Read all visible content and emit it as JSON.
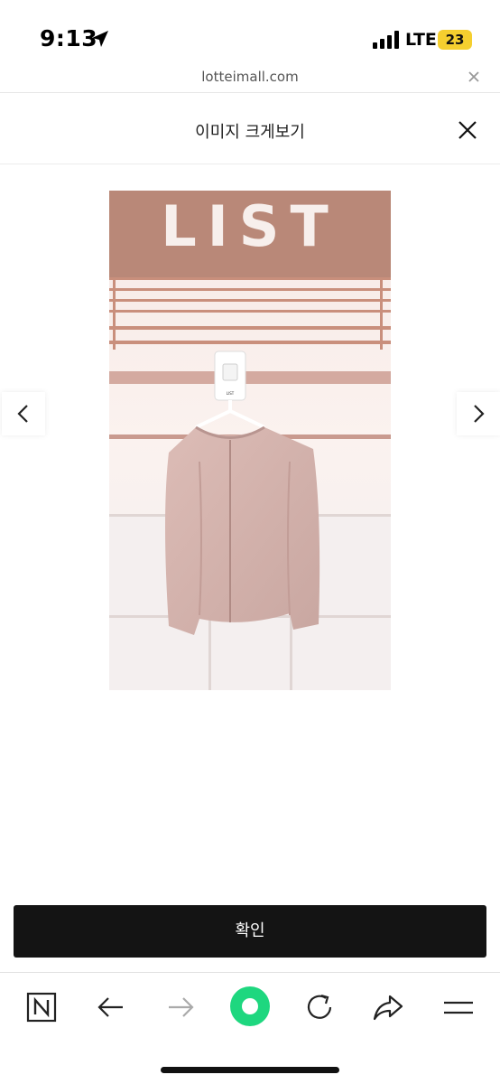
{
  "status_bar": {
    "time": "9:13",
    "network": "LTE",
    "battery": "23"
  },
  "url_bar": {
    "domain": "lotteimall.com"
  },
  "header": {
    "title": "이미지 크게보기"
  },
  "image": {
    "sign_text": "LIST",
    "hanger_tag": "LIST"
  },
  "confirm": {
    "label": "확인"
  },
  "toolbar": {
    "icons": [
      "naver-n-icon",
      "back-arrow-icon",
      "forward-arrow-icon",
      "green-search-icon",
      "reload-icon",
      "share-icon",
      "menu-icon"
    ]
  }
}
